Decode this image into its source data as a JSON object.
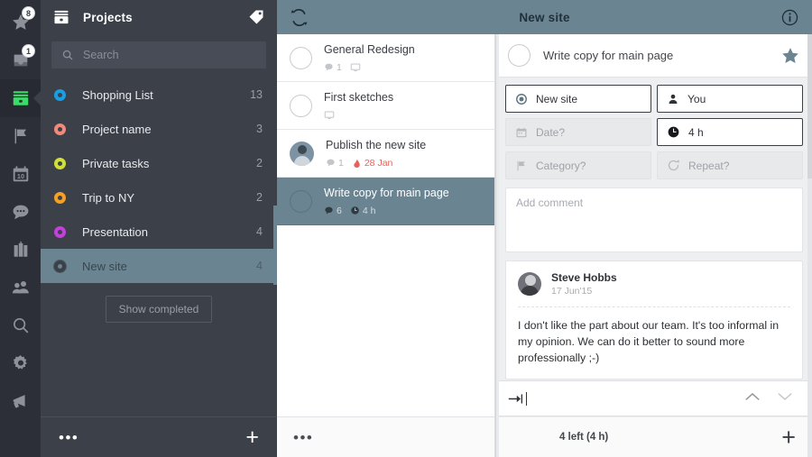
{
  "rail": {
    "items": [
      {
        "name": "starred",
        "icon": "star-icon",
        "badge": "8",
        "active": false
      },
      {
        "name": "inbox",
        "icon": "inbox-icon",
        "badge": "1",
        "active": false
      },
      {
        "name": "projects",
        "icon": "projects-box-icon",
        "badge": "",
        "active": true
      },
      {
        "name": "flags",
        "icon": "flag-icon",
        "badge": "",
        "active": false
      },
      {
        "name": "calendar",
        "icon": "calendar-icon",
        "badge": "",
        "active": false
      },
      {
        "name": "chat",
        "icon": "chat-bubble-icon",
        "badge": "",
        "active": false
      },
      {
        "name": "briefcase",
        "icon": "briefcase-icon",
        "badge": "",
        "active": false
      },
      {
        "name": "contacts",
        "icon": "people-icon",
        "badge": "",
        "active": false
      },
      {
        "name": "search",
        "icon": "search-icon",
        "badge": "",
        "active": false
      },
      {
        "name": "settings",
        "icon": "gear-icon",
        "badge": "",
        "active": false
      },
      {
        "name": "announcements",
        "icon": "megaphone-icon",
        "badge": "",
        "active": false
      }
    ],
    "calendar_day": "10"
  },
  "sidebar": {
    "title": "Projects",
    "tag_icon": "tag-icon",
    "search": {
      "placeholder": "Search",
      "value": "",
      "icon": "search-icon"
    },
    "projects": [
      {
        "label": "Shopping List",
        "count": "13",
        "color": "#189ee5",
        "selected": false
      },
      {
        "label": "Project name",
        "count": "3",
        "color": "#f4887b",
        "selected": false
      },
      {
        "label": "Private tasks",
        "count": "2",
        "color": "#d2e033",
        "selected": false
      },
      {
        "label": "Trip to NY",
        "count": "2",
        "color": "#f5a020",
        "selected": false
      },
      {
        "label": "Presentation",
        "count": "4",
        "color": "#c73ede",
        "selected": false
      },
      {
        "label": "New site",
        "count": "4",
        "color": "#3c4049",
        "selected": true
      }
    ],
    "show_completed_label": "Show completed",
    "footer": {
      "more_label": "•••",
      "add_label": "+"
    }
  },
  "topbar": {
    "sync_icon": "sync-refresh-icon",
    "title": "New site",
    "info_icon": "info-circle-icon"
  },
  "tasklist": {
    "tasks": [
      {
        "title": "General Redesign",
        "comments": "1",
        "has_comments": true,
        "has_screen": true,
        "has_duration": false,
        "duration": "",
        "due": "",
        "avatar": false,
        "selected": false
      },
      {
        "title": "First sketches",
        "comments": "",
        "has_comments": false,
        "has_screen": true,
        "has_duration": false,
        "duration": "",
        "due": "",
        "avatar": false,
        "selected": false
      },
      {
        "title": "Publish the new site",
        "comments": "1",
        "has_comments": true,
        "has_screen": false,
        "has_duration": false,
        "duration": "",
        "due": "28 Jan",
        "avatar": true,
        "selected": false
      },
      {
        "title": "Write copy for main page",
        "comments": "6",
        "has_comments": true,
        "has_screen": false,
        "has_duration": true,
        "duration": "4 h",
        "due": "",
        "avatar": false,
        "selected": true
      }
    ],
    "footer": {
      "more_label": "•••"
    }
  },
  "detail": {
    "task_title": "Write copy for main page",
    "star_icon": "star-icon",
    "star_active": true,
    "fields": [
      {
        "name": "project",
        "icon": "project-dot-icon",
        "label": "New site",
        "state": "filled"
      },
      {
        "name": "assignee",
        "icon": "person-icon",
        "label": "You",
        "state": "filled"
      },
      {
        "name": "date",
        "icon": "calendar-icon",
        "label": "Date?",
        "state": "empty"
      },
      {
        "name": "duration",
        "icon": "clock-icon",
        "label": "4 h",
        "state": "filled"
      },
      {
        "name": "category",
        "icon": "flag-icon",
        "label": "Category?",
        "state": "empty"
      },
      {
        "name": "repeat",
        "icon": "repeat-icon",
        "label": "Repeat?",
        "state": "empty"
      }
    ],
    "add_comment_placeholder": "Add comment",
    "comment": {
      "author": "Steve Hobbs",
      "date": "17 Jun'15",
      "text": "I don't like the part about our team. It's too informal in my opinion. We can do it better to sound more professionally ;-)"
    },
    "compose": {
      "indent_icon": "indent-arrow-icon",
      "value": "",
      "up_icon": "chevron-up-icon",
      "down_icon": "chevron-down-icon"
    },
    "footer": {
      "left_label": "4 left (4 h)",
      "add_label": "+"
    }
  },
  "colors": {
    "accent": "#6b8491",
    "rail_bg": "#2c2f38",
    "sidebar_bg": "#3c4049",
    "due_red": "#e8625a",
    "active_green": "#3ddc6a"
  }
}
